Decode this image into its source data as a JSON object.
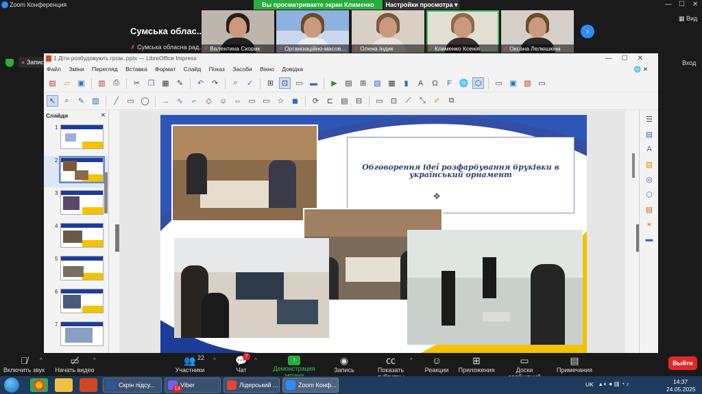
{
  "zoom": {
    "app_title": "Zoom Конференция",
    "share_banner": "Вы просматриваете экран Клименко Ксенія",
    "view_settings": "Настройки просмотра",
    "view_label": "Вид",
    "record_label": "Запись",
    "exit_fullscreen": "Вход"
  },
  "host": {
    "name": "Сумська облас...",
    "sub": "Сумська обласна рад..."
  },
  "participants": [
    {
      "name": "Валентина Скорик"
    },
    {
      "name": "Організаційно-масов..."
    },
    {
      "name": "Олена Індик"
    },
    {
      "name": "Клименко Ксенія"
    },
    {
      "name": "Оксана Лелюшкіна"
    }
  ],
  "impress": {
    "title": "1 Діти розбудовують гром..pptx — LibreOffice Impress",
    "menu": [
      "Файл",
      "Зміни",
      "Перегляд",
      "Вставка",
      "Формат",
      "Слайд",
      "Показ",
      "Засоби",
      "Вікно",
      "Довідка"
    ],
    "slides_header": "Слайди",
    "slide_numbers": [
      "1",
      "2",
      "3",
      "4",
      "5",
      "6",
      "7"
    ],
    "slide_title": "Обговорення ідеї розфарбування бруківки в український орнамент"
  },
  "controls": {
    "mute": "Включить звук",
    "video": "Начать видео",
    "participants": "Участники",
    "participants_count": "22",
    "chat": "Чат",
    "chat_badge": "7",
    "share": "Демонстрация экрана",
    "record": "Запись",
    "captions": "Показать субтитры",
    "reactions": "Реакции",
    "apps": "Приложения",
    "whiteboards": "Доски сообщений",
    "notes": "Примечания",
    "leave": "Выйти"
  },
  "taskbar": {
    "tasks": [
      "Скрін підсу...",
      "Viber",
      "Лідерський ...",
      "Zoom Конф..."
    ],
    "viber_badge": "13",
    "lang": "UK",
    "time": "14:37",
    "date": "24.05.2025"
  },
  "colors": {
    "zoom_green": "#27ae3c",
    "zoom_blue": "#2d8cff",
    "leave_red": "#e02828",
    "slide_blue": "#1c3c9a",
    "slide_yellow": "#f3c300"
  }
}
